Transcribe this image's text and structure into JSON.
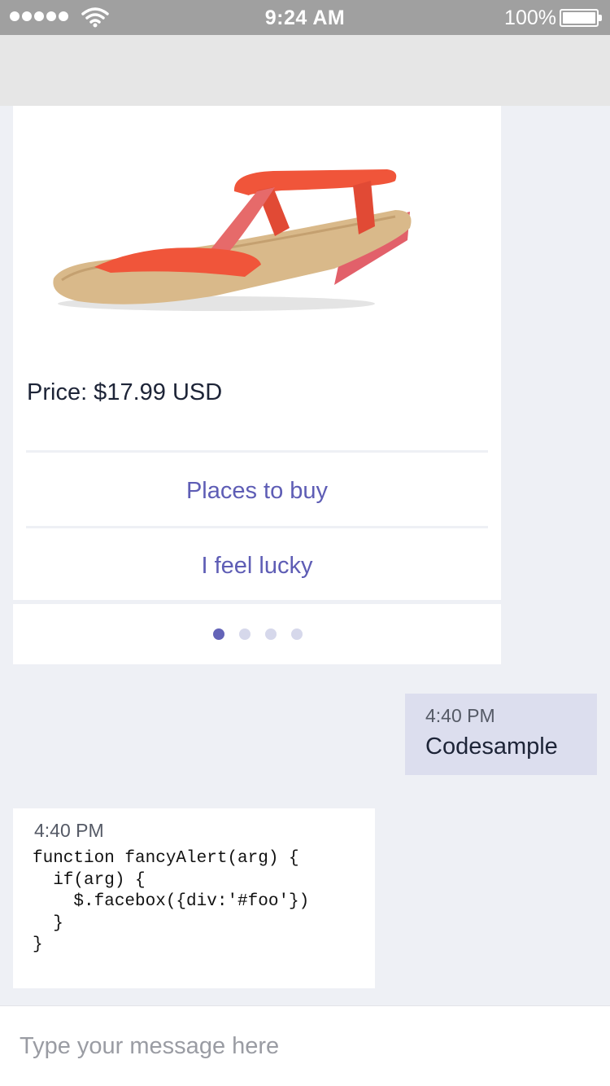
{
  "status_bar": {
    "time": "9:24 AM",
    "battery": "100%",
    "signal_icon": "signal-dots-icon",
    "wifi_icon": "wifi-icon",
    "battery_icon": "battery-icon"
  },
  "product_card": {
    "image_icon": "sandal-product-image",
    "price": "Price: $17.99 USD",
    "buttons": [
      {
        "label": "Places to buy"
      },
      {
        "label": "I feel lucky"
      }
    ],
    "pager": {
      "pages": 4,
      "active_index": 0
    }
  },
  "messages": [
    {
      "direction": "outgoing",
      "time": "4:40 PM",
      "text": "Codesample"
    },
    {
      "direction": "incoming",
      "time": "4:40 PM",
      "code": "function fancyAlert(arg) {\n  if(arg) {\n    $.facebox({div:'#foo'})\n  }\n}"
    }
  ],
  "composer": {
    "placeholder": "Type your message here",
    "value": ""
  },
  "colors": {
    "accent": "#5e5db5",
    "background": "#eef0f5",
    "outgoing_bubble": "#dcdeee",
    "status_bar": "#a0a0a0",
    "sandal_strap": "#f0553a",
    "sandal_sole": "#d8b688"
  }
}
